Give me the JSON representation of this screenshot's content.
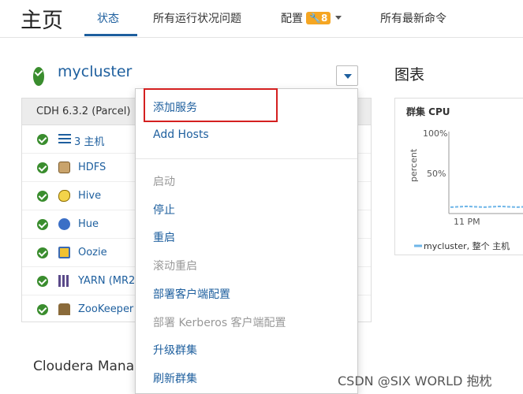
{
  "header": {
    "page_title": "主页",
    "tabs": [
      {
        "label": "状态"
      },
      {
        "label": "所有运行状况问题"
      },
      {
        "label": "配置"
      },
      {
        "label": "所有最新命令"
      }
    ],
    "config_badge": "8"
  },
  "cluster": {
    "name": "mycluster",
    "version": "CDH 6.3.2 (Parcel)",
    "services": [
      {
        "label": "3 主机",
        "icon": "list-icon"
      },
      {
        "label": "HDFS",
        "icon": "hdfs-icon"
      },
      {
        "label": "Hive",
        "icon": "hive-icon"
      },
      {
        "label": "Hue",
        "icon": "hue-icon"
      },
      {
        "label": "Oozie",
        "icon": "oozie-icon"
      },
      {
        "label": "YARN (MR2",
        "icon": "yarn-icon"
      },
      {
        "label": "ZooKeeper",
        "icon": "zookeeper-icon"
      }
    ]
  },
  "menu": {
    "items": [
      {
        "label": "添加服务",
        "disabled": false
      },
      {
        "label": "Add Hosts",
        "disabled": false
      },
      {
        "label": "启动",
        "disabled": true
      },
      {
        "label": "停止",
        "disabled": false
      },
      {
        "label": "重启",
        "disabled": false
      },
      {
        "label": "滚动重启",
        "disabled": true
      },
      {
        "label": "部署客户端配置",
        "disabled": false
      },
      {
        "label": "部署 Kerberos 客户端配置",
        "disabled": true
      },
      {
        "label": "升级群集",
        "disabled": false
      },
      {
        "label": "刷新群集",
        "disabled": false
      }
    ]
  },
  "charts": {
    "section_title": "图表",
    "card": {
      "title": "群集 CPU",
      "ylabel": "percent",
      "y_ticks": [
        "100%",
        "50%"
      ],
      "x_tick": "11 PM",
      "legend": "mycluster, 整个 主机"
    }
  },
  "chart_data": {
    "type": "line",
    "title": "群集 CPU",
    "ylabel": "percent",
    "ylim": [
      0,
      100
    ],
    "x": [
      "11 PM"
    ],
    "series": [
      {
        "name": "mycluster, 整个 主机",
        "values": [
          2,
          3,
          2,
          3,
          2,
          3
        ]
      }
    ]
  },
  "cloudera_manager": {
    "title": "Cloudera Mana"
  },
  "watermark": "CSDN @SIX WORLD 抱枕",
  "colors": {
    "link": "#1e5f9e",
    "ok": "#3a8d2e",
    "badge": "#f5a623",
    "highlight": "#d42020",
    "series": "#6fb6e8"
  }
}
